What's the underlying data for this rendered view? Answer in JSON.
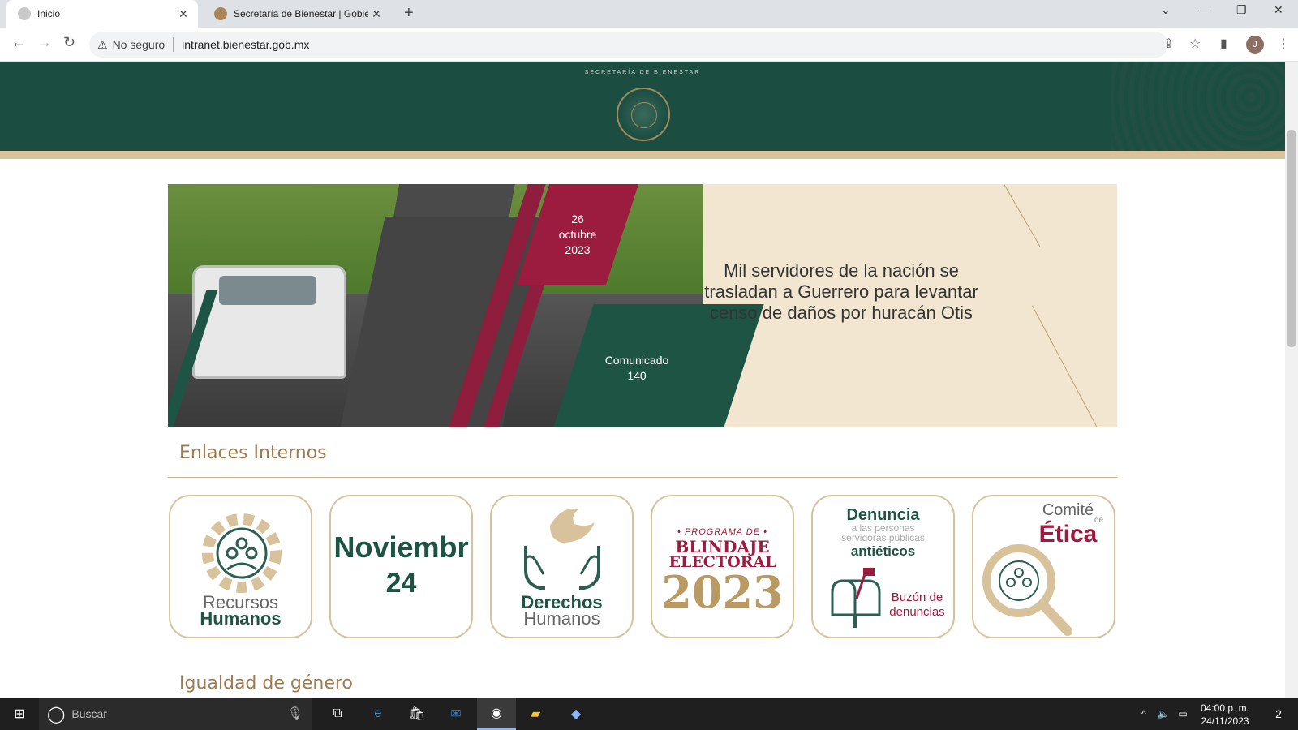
{
  "browser": {
    "tabs": [
      {
        "title": "Inicio",
        "favicon_color": "#c9c9c9"
      },
      {
        "title": "Secretaría de Bienestar | Gobiern",
        "favicon_color": "#a8865a"
      }
    ],
    "new_tab": "+",
    "security_label": "No seguro",
    "url": "intranet.bienestar.gob.mx",
    "avatar_letter": "J"
  },
  "header": {
    "subtitle": "SECRETARÍA DE BIENESTAR",
    "colors": {
      "green": "#1b4d40",
      "band": "#d8c39d"
    }
  },
  "banner": {
    "date_day": "26",
    "date_month": "octubre",
    "date_year": "2023",
    "comunicado_label": "Comunicado",
    "comunicado_number": "140",
    "headline": "Mil servidores de la nación se trasladan a Guerrero para levantar censo de daños por huracán Otis"
  },
  "enlaces": {
    "title": "Enlaces Internos",
    "cards": [
      {
        "line1": "Recursos",
        "line2": "Humanos",
        "icon": "people-gear-icon"
      },
      {
        "line1": "Noviembr",
        "line2": "24",
        "icon": "calendar-date"
      },
      {
        "line1": "Derechos",
        "line2": "Humanos",
        "icon": "dove-hands-icon"
      },
      {
        "line1": "• PROGRAMA DE •",
        "line2": "BLINDAJE",
        "line3": "ELECTORAL",
        "line4": "2023",
        "icon": "blindaje-electoral-logo"
      },
      {
        "line1": "Denuncia",
        "line2": "a las personas",
        "line3": "servidoras públicas",
        "line4": "antiéticos",
        "line5": "Buzón de",
        "line6": "denuncias",
        "icon": "mailbox-icon"
      },
      {
        "line1": "Comité",
        "line2": "de",
        "line3": "Ética",
        "icon": "magnifier-people-icon"
      }
    ]
  },
  "igualdad": {
    "title": "Igualdad de género"
  },
  "taskbar": {
    "search_placeholder": "Buscar",
    "time": "04:00 p. m.",
    "date": "24/11/2023",
    "notifications": "2"
  }
}
